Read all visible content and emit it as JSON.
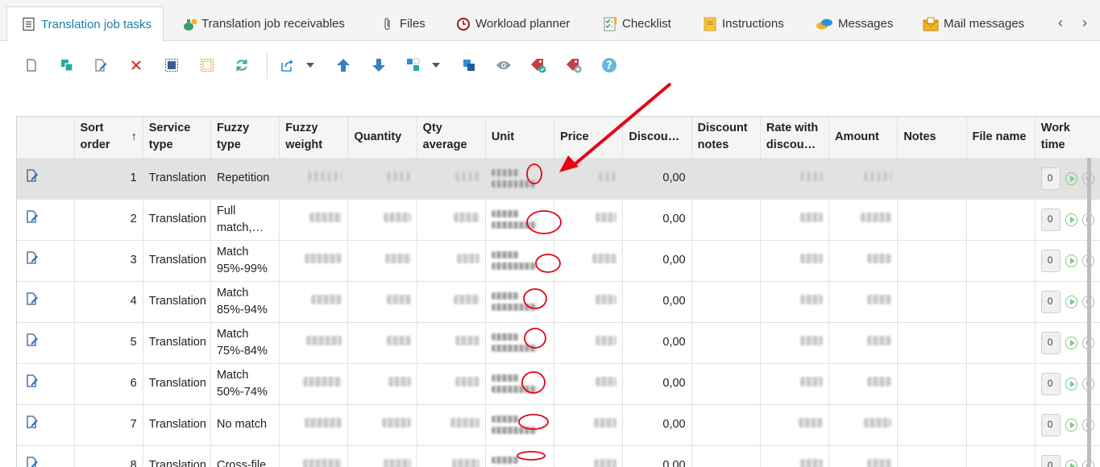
{
  "tabs": [
    {
      "label": "Translation job tasks",
      "icon": "list-icon",
      "active": true
    },
    {
      "label": "Translation job receivables",
      "icon": "money-bag-icon",
      "active": false
    },
    {
      "label": "Files",
      "icon": "paperclip-icon",
      "active": false
    },
    {
      "label": "Workload planner",
      "icon": "clock-icon",
      "active": false
    },
    {
      "label": "Checklist",
      "icon": "checklist-icon",
      "active": false
    },
    {
      "label": "Instructions",
      "icon": "note-icon",
      "active": false
    },
    {
      "label": "Messages",
      "icon": "chat-bubbles-icon",
      "active": false
    },
    {
      "label": "Mail messages",
      "icon": "envelope-icon",
      "active": false
    }
  ],
  "toolbar": {
    "buttons": [
      "new-icon",
      "copy-icon",
      "edit-icon",
      "delete-icon",
      "select-all-icon",
      "deselect-icon",
      "refresh-icon",
      "export-icon",
      "move-up-icon",
      "move-down-icon",
      "split-icon",
      "merge-icon",
      "view-icon",
      "tag-apply-icon",
      "tag-add-icon",
      "help-icon"
    ]
  },
  "grid": {
    "columns": [
      "",
      "Sort order",
      "Service type",
      "Fuzzy type",
      "Fuzzy weight",
      "Quantity",
      "Qty average",
      "Unit",
      "Price",
      "Discou…",
      "Discount notes",
      "Rate with discou…",
      "Amount",
      "Notes",
      "File name",
      "Work time"
    ],
    "sort_indicator": "↑",
    "rows": [
      {
        "sort": "1",
        "service": "Translation",
        "fuzzy": "Repetition",
        "discount": "0,00",
        "work": "0",
        "selected": true
      },
      {
        "sort": "2",
        "service": "Translation",
        "fuzzy": "Full match,…",
        "discount": "0,00",
        "work": "0"
      },
      {
        "sort": "3",
        "service": "Translation",
        "fuzzy": "Match 95%-99%",
        "discount": "0,00",
        "work": "0"
      },
      {
        "sort": "4",
        "service": "Translation",
        "fuzzy": "Match 85%-94%",
        "discount": "0,00",
        "work": "0"
      },
      {
        "sort": "5",
        "service": "Translation",
        "fuzzy": "Match 75%-84%",
        "discount": "0,00",
        "work": "0"
      },
      {
        "sort": "6",
        "service": "Translation",
        "fuzzy": "Match 50%-74%",
        "discount": "0,00",
        "work": "0"
      },
      {
        "sort": "7",
        "service": "Translation",
        "fuzzy": "No match",
        "discount": "0,00",
        "work": "0"
      },
      {
        "sort": "8",
        "service": "Translation",
        "fuzzy": "Cross-file",
        "discount": "0,00",
        "work": "0"
      }
    ]
  },
  "colors": {
    "accent": "#1b7fa6",
    "annotation": "#e30613",
    "teal": "#27a9a0"
  }
}
